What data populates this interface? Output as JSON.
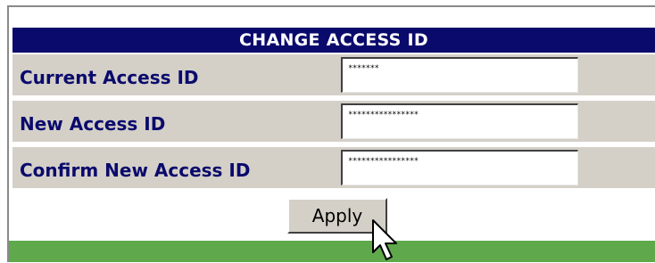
{
  "form": {
    "title": "CHANGE ACCESS ID",
    "fields": [
      {
        "label": "Current Access ID",
        "value": "*******"
      },
      {
        "label": "New Access ID",
        "value": "****************"
      },
      {
        "label": "Confirm New Access ID",
        "value": "****************"
      }
    ],
    "apply_label": "Apply"
  },
  "colors": {
    "title_bg": "#0a0a6c",
    "label_text": "#0a0a6c",
    "row_bg": "#d4d0c8",
    "footer_bar": "#5fa84c"
  },
  "icons": {
    "cursor": "mouse-pointer-icon"
  }
}
